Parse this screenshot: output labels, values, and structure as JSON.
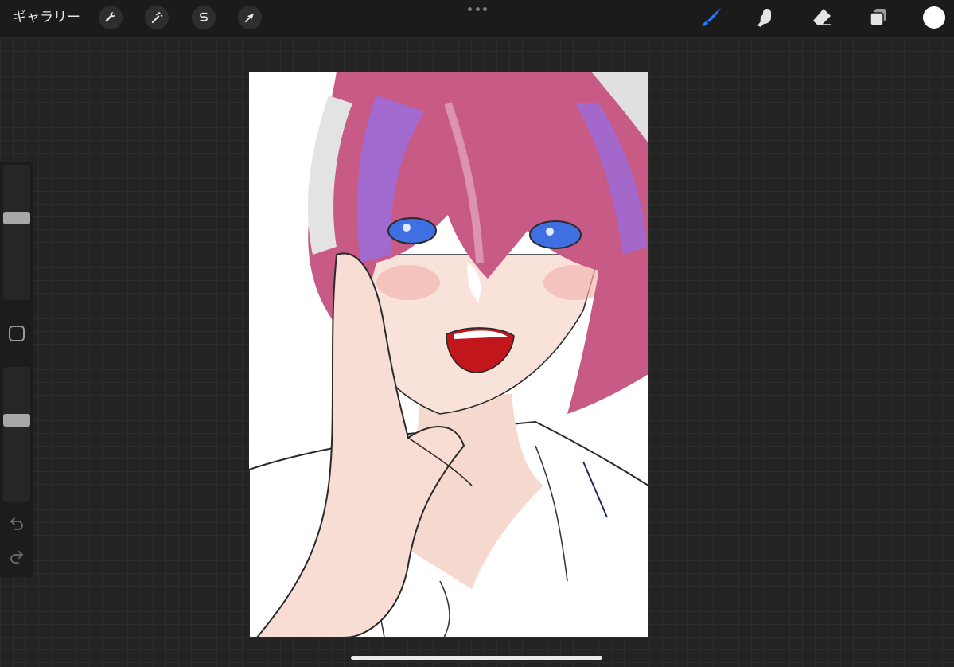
{
  "topbar": {
    "gallery_label": "ギャラリー",
    "left_tools": [
      {
        "name": "actions",
        "icon": "wrench-icon"
      },
      {
        "name": "adjustments",
        "icon": "magic-wand-icon"
      },
      {
        "name": "selection",
        "icon": "selection-s-icon"
      },
      {
        "name": "transform",
        "icon": "arrow-cursor-icon"
      }
    ],
    "more_icon": "more-dots-icon",
    "right_tools": [
      {
        "name": "paint-brush",
        "icon": "brush-icon",
        "active": true
      },
      {
        "name": "smudge",
        "icon": "smudge-finger-icon",
        "active": false
      },
      {
        "name": "eraser",
        "icon": "eraser-icon",
        "active": false
      },
      {
        "name": "layers",
        "icon": "layers-icon",
        "active": false
      }
    ],
    "current_color": "#ffffff"
  },
  "sidebar": {
    "brush_size_level": 0.62,
    "opacity_level": 0.62,
    "modify_icon": "square-modify-icon",
    "undo_icon": "undo-icon",
    "redo_icon": "redo-icon"
  },
  "colors": {
    "active_tool": "#1e7bff",
    "background": "#232323",
    "toolbar": "#1b1b1b",
    "canvas": "#ffffff",
    "hair_pink": "#c85a86",
    "hair_purple": "#9d6ad6",
    "eye_blue": "#3f6fe0",
    "mouth_red": "#c0161c",
    "skin": "#f5d9cf"
  }
}
